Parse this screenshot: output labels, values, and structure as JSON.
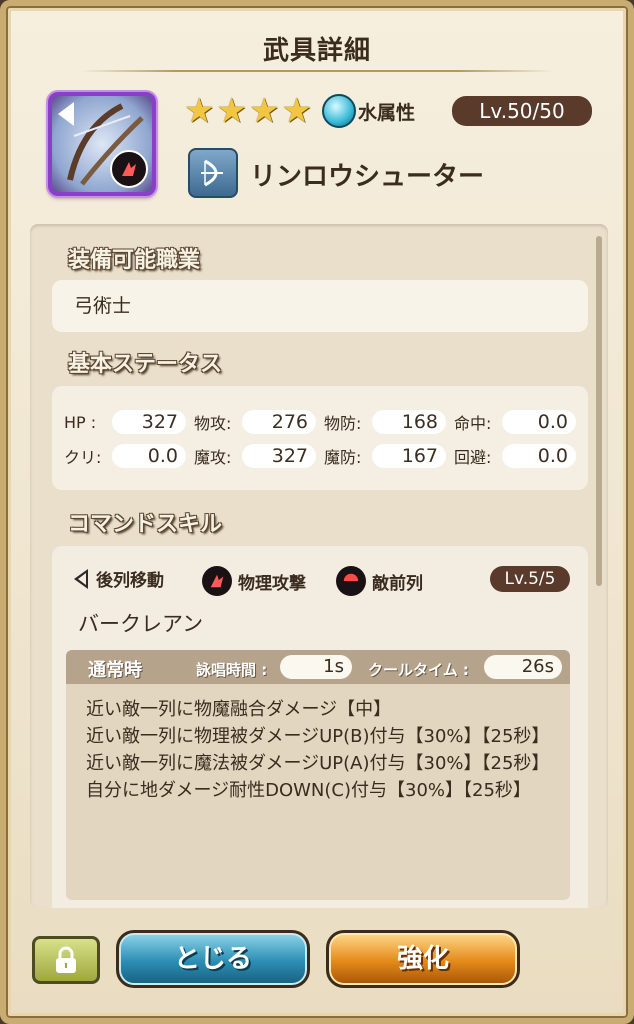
{
  "header": {
    "title": "武具詳細"
  },
  "weapon": {
    "stars": [
      "★",
      "★",
      "★",
      "★"
    ],
    "element_label": "水属性",
    "level": "Lv.50/50",
    "name": "リンロウシューター",
    "icon": "bow-weapon-icon"
  },
  "equip_jobs": {
    "title": "装備可能職業",
    "value": "弓術士"
  },
  "base_status": {
    "title": "基本ステータス",
    "rows": [
      [
        {
          "label": "HP :",
          "value": "327"
        },
        {
          "label": "物攻:",
          "value": "276"
        },
        {
          "label": "物防:",
          "value": "168"
        },
        {
          "label": "命中:",
          "value": "0.0"
        }
      ],
      [
        {
          "label": "クリ:",
          "value": "0.0"
        },
        {
          "label": "魔攻:",
          "value": "327"
        },
        {
          "label": "魔防:",
          "value": "167"
        },
        {
          "label": "回避:",
          "value": "0.0"
        }
      ]
    ]
  },
  "command_skill": {
    "title": "コマンドスキル",
    "tags": [
      "後列移動",
      "物理攻撃",
      "敵前列"
    ],
    "level": "Lv.5/5",
    "name": "バークレアン",
    "normal": {
      "label": "通常時",
      "cast_label": "詠唱時間 :",
      "cast_value": "1s",
      "cool_label": "クールタイム :",
      "cool_value": "26s"
    },
    "description": [
      "近い敵一列に物魔融合ダメージ【中】",
      "近い敵一列に物理被ダメージUP(B)付与【30%】【25秒】",
      "近い敵一列に魔法被ダメージUP(A)付与【30%】【25秒】",
      "自分に地ダメージ耐性DOWN(C)付与【30%】【25秒】"
    ]
  },
  "buttons": {
    "close": "とじる",
    "enhance": "強化",
    "lock_icon": "lock-icon"
  },
  "colors": {
    "badge": "#5a3a2a",
    "close_btn": "#2c8db4",
    "enhance_btn": "#e38a1a",
    "rarity_frame": "#8a3fc9"
  }
}
